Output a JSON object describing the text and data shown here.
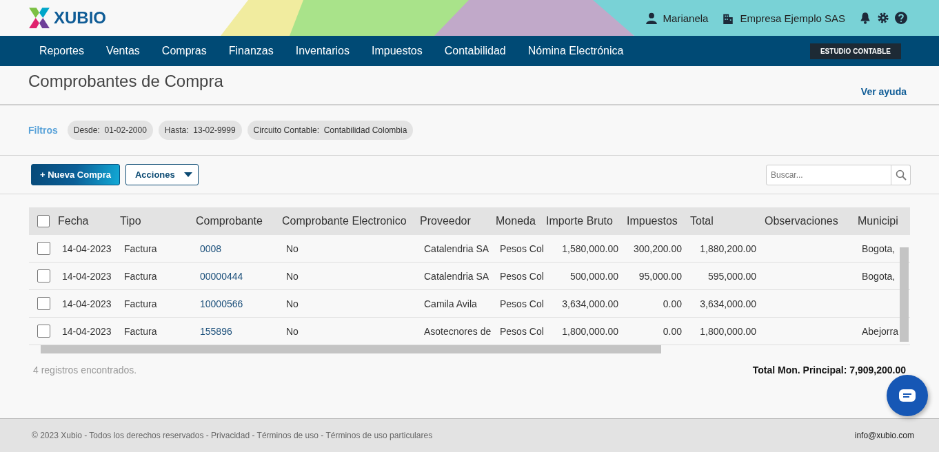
{
  "brand": {
    "name": "XUBIO"
  },
  "user": {
    "name": "Marianela",
    "company": "Empresa Ejemplo SAS"
  },
  "nav": {
    "items": [
      "Reportes",
      "Ventas",
      "Compras",
      "Finanzas",
      "Inventarios",
      "Impuestos",
      "Contabilidad",
      "Nómina Electrónica"
    ],
    "studio_button": "ESTUDIO CONTABLE"
  },
  "page": {
    "title": "Comprobantes de Compra",
    "help_link": "Ver ayuda"
  },
  "filters": {
    "label": "Filtros",
    "chips": [
      {
        "label": "Desde:",
        "value": "01-02-2000"
      },
      {
        "label": "Hasta:",
        "value": "13-02-9999"
      },
      {
        "label": "Circuito Contable:",
        "value": "Contabilidad Colombia"
      }
    ]
  },
  "toolbar": {
    "new_button": "+ Nueva Compra",
    "actions_button": "Acciones",
    "search": {
      "placeholder": "Buscar..."
    }
  },
  "table": {
    "select_all_checked": false,
    "columns": [
      {
        "label": "Fecha",
        "kind": "text"
      },
      {
        "label": "Tipo",
        "kind": "text"
      },
      {
        "label": "Comprobante",
        "kind": "link"
      },
      {
        "label": "Comprobante Electronico",
        "kind": "text"
      },
      {
        "label": "Proveedor",
        "kind": "text"
      },
      {
        "label": "Moneda",
        "kind": "text"
      },
      {
        "label": "Importe Bruto",
        "kind": "number"
      },
      {
        "label": "Impuestos",
        "kind": "number"
      },
      {
        "label": "Total",
        "kind": "number"
      },
      {
        "label": "Observaciones",
        "kind": "text"
      },
      {
        "label": "Municipi",
        "kind": "text"
      }
    ],
    "rows": [
      {
        "checked": false,
        "cells": [
          "14-04-2023",
          "Factura",
          "0008",
          "No",
          "Catalendria SA",
          "Pesos Col",
          "1,580,000.00",
          "300,200.00",
          "1,880,200.00",
          "",
          "Bogota,"
        ]
      },
      {
        "checked": false,
        "cells": [
          "14-04-2023",
          "Factura",
          "00000444",
          "No",
          "Catalendria SA",
          "Pesos Col",
          "500,000.00",
          "95,000.00",
          "595,000.00",
          "",
          "Bogota,"
        ]
      },
      {
        "checked": false,
        "cells": [
          "14-04-2023",
          "Factura",
          "10000566",
          "No",
          "Camila Avila",
          "Pesos Col",
          "3,634,000.00",
          "0.00",
          "3,634,000.00",
          "",
          ""
        ]
      },
      {
        "checked": false,
        "cells": [
          "14-04-2023",
          "Factura",
          "155896",
          "No",
          "Asotecnores de",
          "Pesos Col",
          "1,800,000.00",
          "0.00",
          "1,800,000.00",
          "",
          "Abejorra"
        ]
      }
    ]
  },
  "summary": {
    "count": "4 registros encontrados.",
    "total": "Total Mon. Principal: 7,909,200.00"
  },
  "footer": {
    "links": [
      "© 2023 Xubio - Todos los derechos reservados - Privacidad - Términos de uso - Términos de uso particulares"
    ],
    "email": "info@xubio.com"
  }
}
